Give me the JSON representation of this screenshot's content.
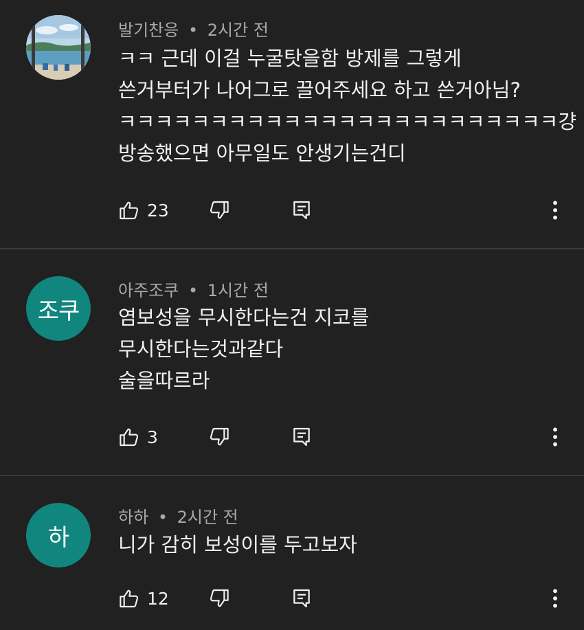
{
  "comments": [
    {
      "author": "발기찬응",
      "time": "2시간 전",
      "separator": "•",
      "avatar_type": "photo",
      "avatar_text": "",
      "lines": [
        "ㅋㅋ 근데 이걸 누굴탓을함 방제를 그렇게",
        "쓴거부터가 나어그로 끌어주세요 하고 쓴거아님?",
        "ㅋㅋㅋㅋㅋㅋㅋㅋㅋㅋㅋㅋㅋㅋㅋㅋㅋㅋㅋㅋㅋㅋㅋㅋ걍",
        "방송했으면 아무일도 안생기는건디"
      ],
      "likes": "23"
    },
    {
      "author": "아주조쿠",
      "time": "1시간 전",
      "separator": "•",
      "avatar_type": "initials",
      "avatar_text": "조쿠",
      "lines": [
        "염보성을 무시한다는건 지코를",
        "무시한다는것과같다",
        "술을따르라"
      ],
      "likes": "3"
    },
    {
      "author": "하하",
      "time": "2시간 전",
      "separator": "•",
      "avatar_type": "initials",
      "avatar_text": "하",
      "lines": [
        "니가 감히 보성이를 두고보자"
      ],
      "likes": "12"
    }
  ],
  "colors": {
    "background": "#212121",
    "avatar_teal": "#11867f",
    "meta_text": "#a9a9a9",
    "body_text": "#f1f1f1",
    "divider": "#3a3a3a"
  },
  "icons": {
    "like": "thumbs-up-icon",
    "dislike": "thumbs-down-icon",
    "reply": "reply-icon",
    "more": "more-vertical-icon"
  }
}
